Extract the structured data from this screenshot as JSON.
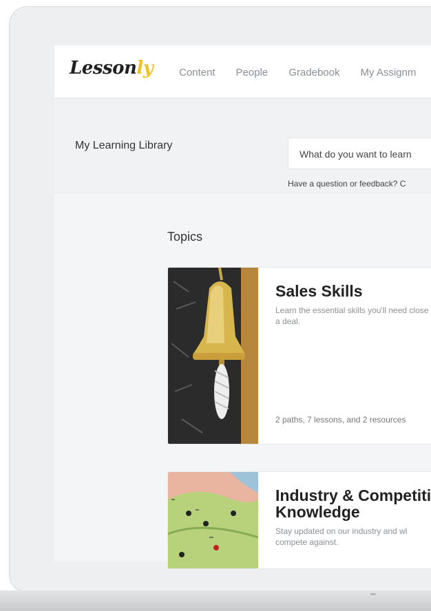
{
  "brand": {
    "logo_main": "Lesson",
    "logo_accent": "ly",
    "accent_color": "#f2c125"
  },
  "nav": {
    "items": [
      {
        "label": "Content"
      },
      {
        "label": "People"
      },
      {
        "label": "Gradebook"
      },
      {
        "label": "My Assignm"
      }
    ]
  },
  "header": {
    "title": "My Learning Library",
    "search_text": "What do you want to learn",
    "feedback_text": "Have a question or feedback? C"
  },
  "topics": {
    "label": "Topics",
    "cards": [
      {
        "title": "Sales Skills",
        "description": "Learn the essential skills you'll need close a deal.",
        "meta": "2 paths, 7 lessons, and 2 resources"
      },
      {
        "title": "Industry & Competiti Knowledge",
        "description": "Stay updated on our industry and wl compete against.",
        "meta": ""
      }
    ]
  }
}
